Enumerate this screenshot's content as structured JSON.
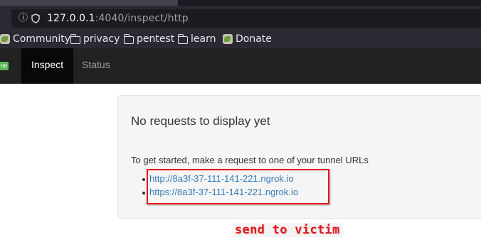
{
  "browser": {
    "address_bar": {
      "host": "127.0.0.1",
      "path": ":4040/inspect/http",
      "info_icon": "info-icon",
      "shield_icon": "shield-icon"
    },
    "bookmarks": [
      {
        "label": "Community",
        "icon": "dragon-favicon"
      },
      {
        "label": "privacy",
        "icon": "folder-icon"
      },
      {
        "label": "pentest",
        "icon": "folder-icon"
      },
      {
        "label": "learn",
        "icon": "folder-icon"
      },
      {
        "label": "Donate",
        "icon": "dragon-favicon"
      }
    ]
  },
  "nav": {
    "badge": "ne",
    "items": [
      "Inspect",
      "Status"
    ],
    "active": "Inspect"
  },
  "main": {
    "heading": "No requests to display yet",
    "intro": "To get started, make a request to one of your tunnel URLs",
    "tunnel_urls": [
      "http://8a3f-37-111-141-221.ngrok.io",
      "https://8a3f-37-111-141-221.ngrok.io"
    ]
  },
  "annotation": {
    "text": "send to victim",
    "color": "#e8161c"
  },
  "colors": {
    "navbar": "#222222",
    "link": "#337ab7",
    "badge": "#5cb85c"
  }
}
